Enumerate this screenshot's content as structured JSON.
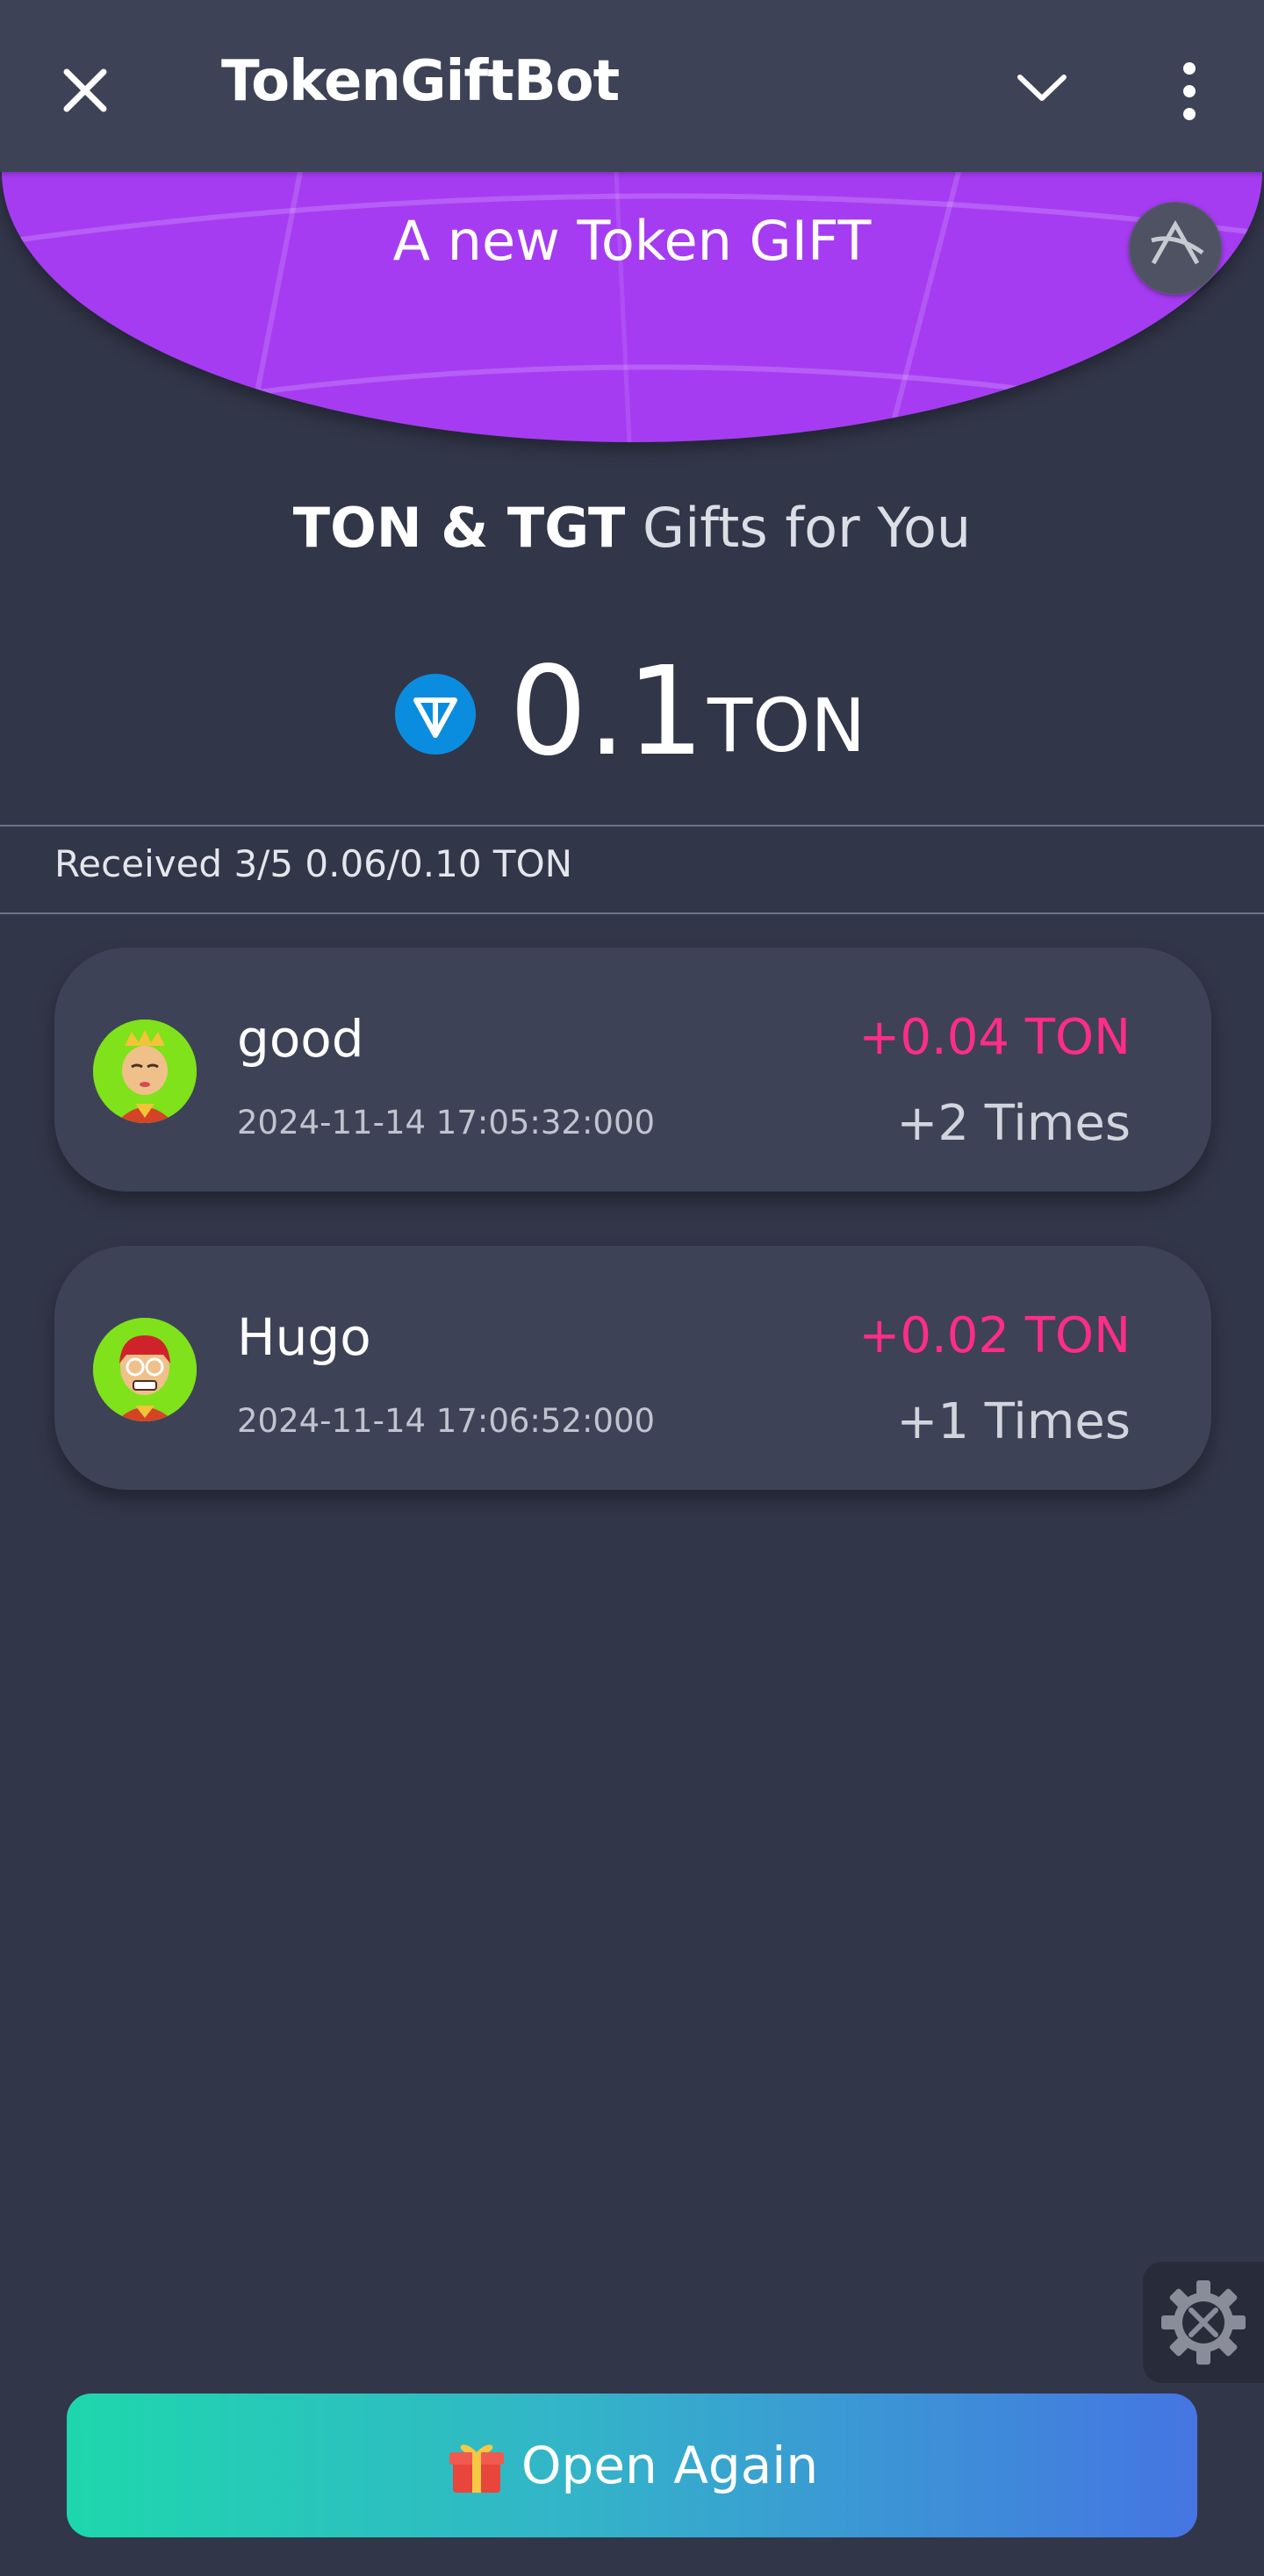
{
  "header": {
    "title": "TokenGiftBot"
  },
  "banner": {
    "text": "A new Token GIFT"
  },
  "gift": {
    "title_bold": "TON & TGT",
    "title_rest": "Gifts for You",
    "amount": "0.1",
    "unit": "TON"
  },
  "summary": {
    "received": "Received 3/5 0.06/0.10 TON"
  },
  "recipients": [
    {
      "name": "good",
      "time": "2024-11-14 17:05:32:000",
      "amount": "+0.04 TON",
      "times": "+2 Times"
    },
    {
      "name": "Hugo",
      "time": "2024-11-14 17:06:52:000",
      "amount": "+0.02 TON",
      "times": "+1 Times"
    }
  ],
  "actions": {
    "open_again": "Open Again"
  },
  "colors": {
    "background": "#323649",
    "banner": "#a53cf2",
    "amount_pink": "#ff2c8a",
    "button_gradient_start": "#1ed7ad",
    "button_gradient_end": "#4575e2"
  },
  "icons": [
    "close-icon",
    "chevron-down-icon",
    "more-vert-icon",
    "ton-logo-icon",
    "app-logo-icon",
    "settings-gear-icon",
    "gift-icon"
  ]
}
